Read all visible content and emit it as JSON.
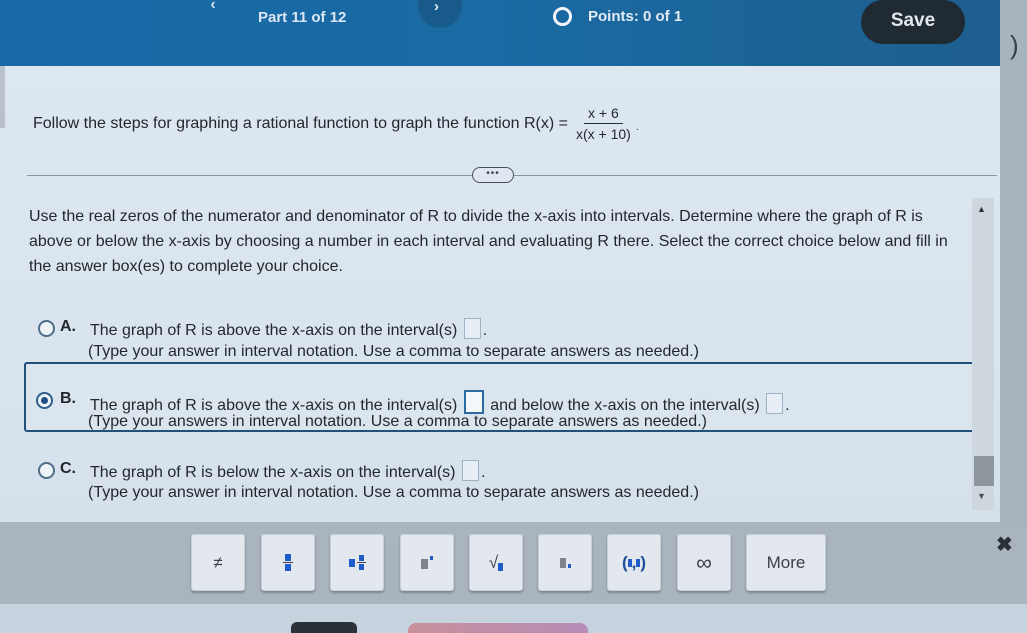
{
  "header": {
    "prev_icon": "‹",
    "next_icon": "›",
    "part_label": "Part 11 of 12",
    "points_label": "Points: 0 of 1",
    "save_label": "Save",
    "edge_glyph": ")"
  },
  "question": {
    "prompt_text": "Follow the steps for graphing a rational function to graph the function R(x) =",
    "function": {
      "numerator": "x + 6",
      "denominator": "x(x + 10)",
      "trailing": "."
    },
    "expand_label": "•••",
    "instructions": "Use the real zeros of the numerator and denominator of R to divide the x-axis into intervals. Determine where the graph of R is above or below the x-axis by choosing a number in each interval and evaluating R there. Select the correct choice below and fill in the answer box(es) to complete your choice."
  },
  "choices": [
    {
      "letter": "A.",
      "selected": false,
      "text_before": "The graph of R is above the x-axis on the interval(s)",
      "text_after": ".",
      "hint": "(Type your answer in interval notation. Use a comma to separate answers as needed.)",
      "answer": ""
    },
    {
      "letter": "B.",
      "selected": true,
      "text_before": "The graph of R is above the x-axis on the interval(s)",
      "text_middle": "and below the x-axis on the interval(s)",
      "text_after": ".",
      "hint": "(Type your answers in interval notation. Use a comma to separate answers as needed.)",
      "answer_above": "",
      "answer_below": ""
    },
    {
      "letter": "C.",
      "selected": false,
      "text_before": "The graph of R is below the x-axis on the interval(s)",
      "text_after": ".",
      "hint": "(Type your answer in interval notation. Use a comma to separate answers as needed.)",
      "answer": ""
    }
  ],
  "scrollbar": {
    "up_icon": "▲",
    "down_icon": "▼"
  },
  "toolbar": {
    "buttons": [
      {
        "name": "not-equal",
        "glyph": "≠"
      },
      {
        "name": "fraction"
      },
      {
        "name": "mixed-number"
      },
      {
        "name": "exponent"
      },
      {
        "name": "square-root",
        "glyph": "√"
      },
      {
        "name": "subscript"
      },
      {
        "name": "interval",
        "glyph_left": "(",
        "glyph_comma": ",",
        "glyph_right": ")"
      },
      {
        "name": "infinity",
        "glyph": "∞"
      },
      {
        "name": "more",
        "label": "More"
      }
    ],
    "close_icon": "✖"
  },
  "colors": {
    "header_blue": "#1769a6",
    "save_button": "#1f2a33",
    "selected_frame": "#22507d",
    "template_blue": "#1f5bc9"
  }
}
